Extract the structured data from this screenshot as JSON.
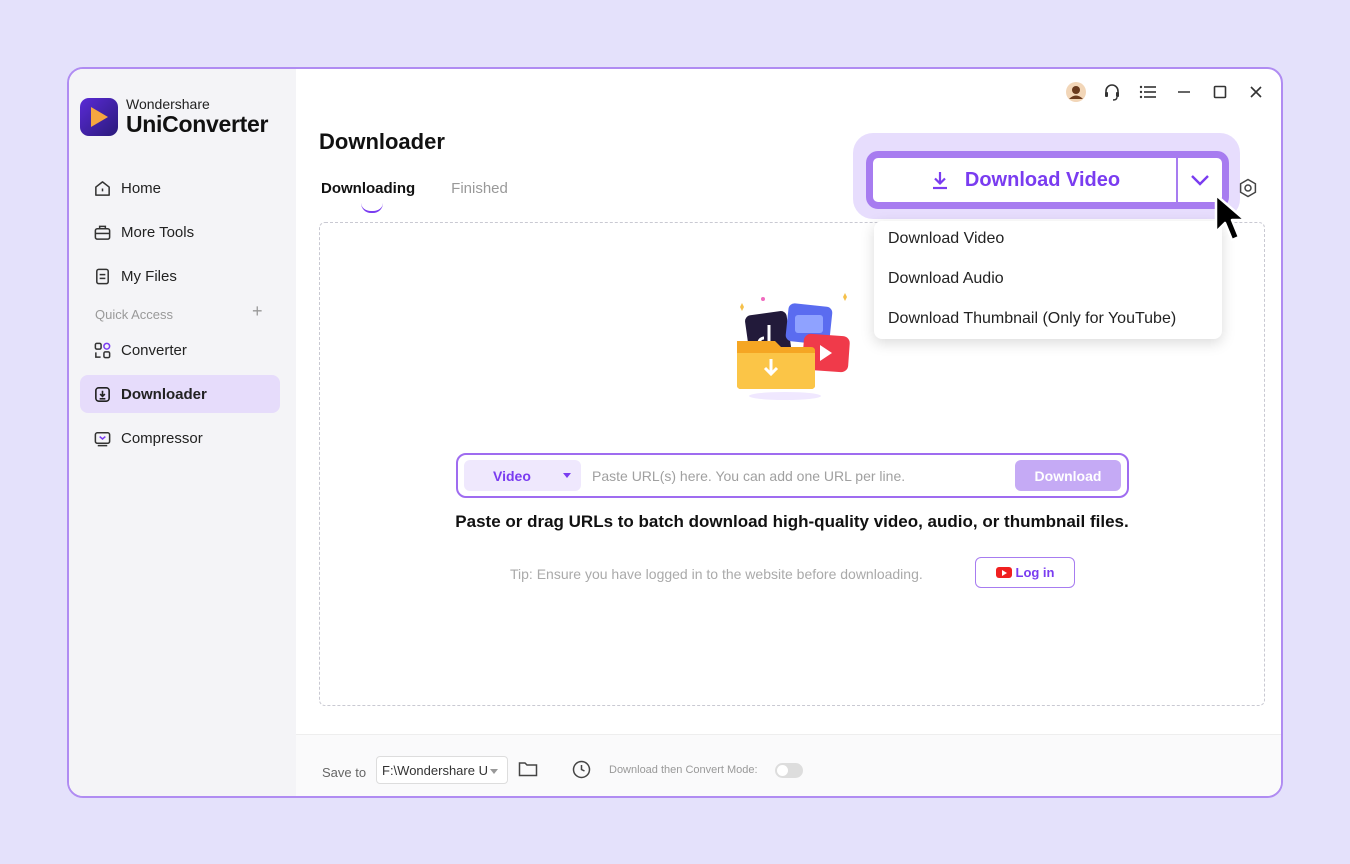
{
  "app": {
    "brand_small": "Wondershare",
    "brand_big": "UniConverter",
    "accent": "#7a3cf0"
  },
  "sidebar": {
    "items": [
      {
        "label": "Home",
        "icon": "home-icon"
      },
      {
        "label": "More Tools",
        "icon": "toolbox-icon"
      },
      {
        "label": "My Files",
        "icon": "files-icon"
      }
    ],
    "quick_access_label": "Quick Access",
    "quick_items": [
      {
        "label": "Converter",
        "icon": "converter-icon"
      },
      {
        "label": "Downloader",
        "icon": "downloader-icon",
        "active": true
      },
      {
        "label": "Compressor",
        "icon": "compressor-icon"
      }
    ]
  },
  "main": {
    "title": "Downloader",
    "tabs": [
      {
        "label": "Downloading",
        "active": true
      },
      {
        "label": "Finished",
        "active": false
      }
    ],
    "url_bar": {
      "type_value": "Video",
      "placeholder": "Paste URL(s) here. You can add one URL per line.",
      "download_label": "Download"
    },
    "headline": "Paste or drag URLs to batch download high-quality video, audio, or thumbnail files.",
    "tip": "Tip: Ensure you have logged in to the website before downloading.",
    "login_label": "Log in"
  },
  "download_split": {
    "label": "Download Video",
    "menu": [
      "Download Video",
      "Download Audio",
      "Download Thumbnail (Only for YouTube)"
    ]
  },
  "footer": {
    "save_to_label": "Save to",
    "path_value": "F:\\Wondershare U",
    "mode_label": "Download then Convert Mode:"
  }
}
